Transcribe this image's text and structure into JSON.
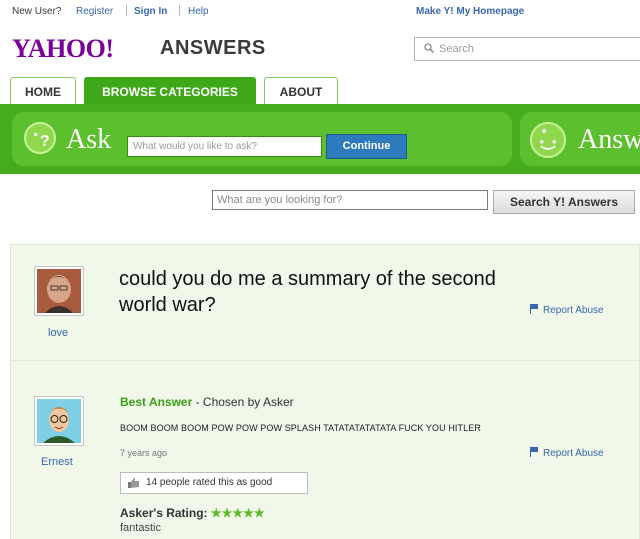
{
  "topbar": {
    "new_user": "New User?",
    "register": "Register",
    "sign_in": "Sign In",
    "help": "Help",
    "make_homepage": "Make Y! My Homepage"
  },
  "header": {
    "logo_yahoo": "YAHOO!",
    "logo_answers": "ANSWERS",
    "search_placeholder": "Search"
  },
  "tabs": [
    {
      "label": "HOME",
      "active": false
    },
    {
      "label": "BROWSE CATEGORIES",
      "active": true
    },
    {
      "label": "ABOUT",
      "active": false
    }
  ],
  "askbar": {
    "ask_label": "Ask",
    "ask_placeholder": "What would you like to ask?",
    "continue_label": "Continue",
    "answer_label": "Answ"
  },
  "search2": {
    "placeholder": "What are you looking for?",
    "button_label": "Search Y! Answers"
  },
  "question": {
    "title": "could you do me a summary of the second world war?",
    "asker_name": "love",
    "report_label": "Report Abuse"
  },
  "answer": {
    "best_label": "Best Answer",
    "chosen_by": " - Chosen by Asker",
    "text": "BOOM BOOM BOOM POW POW POW SPLASH TATATATATATATA  FUCK YOU HITLER",
    "time_ago": "7 years ago",
    "answerer_name": "Ernest",
    "report_label": "Report Abuse",
    "rating_count": "14 people rated this as good",
    "askers_rating_label": "Asker's Rating:",
    "stars": "★★★★★",
    "stars_value": 5,
    "comment": "fantastic"
  },
  "colors": {
    "brand_purple": "#7b0099",
    "green_bar": "#45ad1d",
    "link_blue": "#3a67b2",
    "best_answer_green": "#3aa116"
  }
}
